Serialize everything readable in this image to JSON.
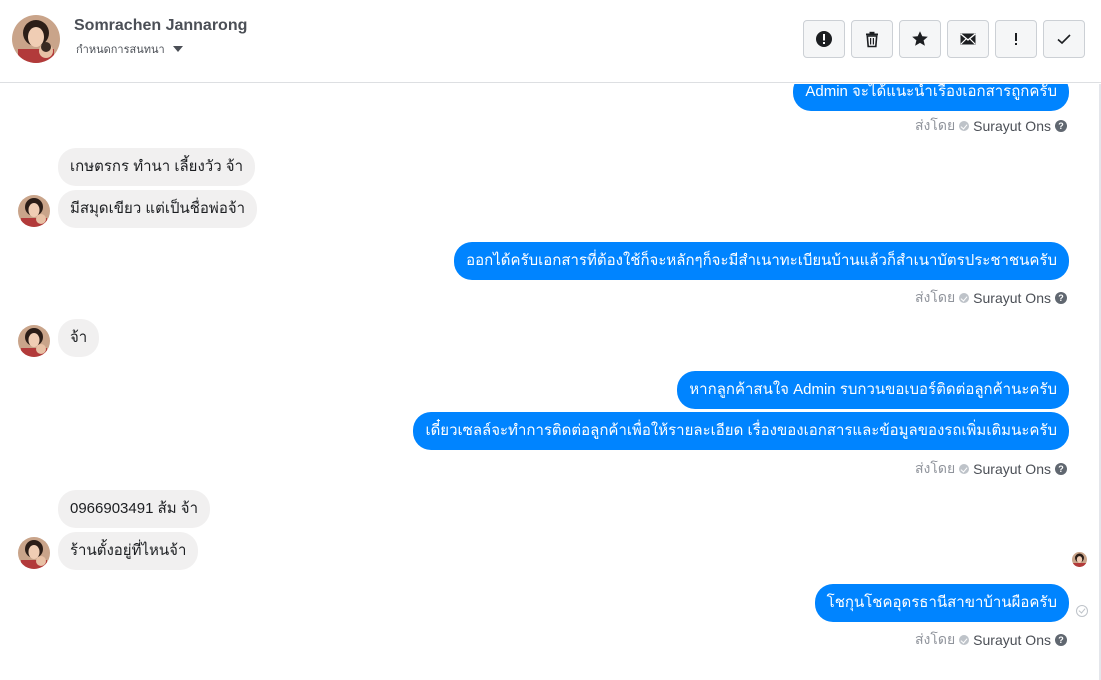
{
  "header": {
    "contact_name": "Somrachen Jannarong",
    "subtitle": "กำหนดการสนทนา",
    "actions": [
      {
        "name": "mark-spam-button",
        "icon": "alert-circle-icon"
      },
      {
        "name": "delete-button",
        "icon": "trash-icon"
      },
      {
        "name": "star-button",
        "icon": "star-icon"
      },
      {
        "name": "mark-unread-button",
        "icon": "envelope-icon"
      },
      {
        "name": "follow-up-button",
        "icon": "exclamation-icon"
      },
      {
        "name": "mark-done-button",
        "icon": "checkmark-icon"
      }
    ]
  },
  "conversation": {
    "sent_by_label": "ส่งโดย",
    "agent_name": "Surayut Ons",
    "messages": [
      {
        "direction": "out",
        "text": "Admin จะได้แนะนำเรื่องเอกสารถูกครับ"
      },
      {
        "direction": "in",
        "text": "เกษตรกร ทำนา เลี้ยงวัว จ้า"
      },
      {
        "direction": "in",
        "text": "มีสมุดเขียว  แต่เป็นชื่อพ่อจ้า"
      },
      {
        "direction": "out",
        "text": "ออกได้ครับเอกสารที่ต้องใช้ก็จะหลักๆก็จะมีสำเนาทะเบียนบ้านแล้วก็สำเนาบัตรประชาชนครับ"
      },
      {
        "direction": "in",
        "text": "จ้า"
      },
      {
        "direction": "out",
        "text": "หากลูกค้าสนใจ Admin รบกวนขอเบอร์ติดต่อลูกค้านะครับ"
      },
      {
        "direction": "out",
        "text": "เดี๋ยวเซลล์จะทำการติดต่อลูกค้าเพื่อให้รายละเอียด เรื่องของเอกสารและข้อมูลของรถเพิ่มเติมนะครับ"
      },
      {
        "direction": "in",
        "text": "0966903491 ส้ม จ้า"
      },
      {
        "direction": "in",
        "text": "ร้านตั้งอยู่ที่ไหนจ้า"
      },
      {
        "direction": "out",
        "text": "โชกุนโชคอุดรธานีสาขาบ้านผือครับ"
      }
    ]
  },
  "colors": {
    "outgoing_bubble": "#0084ff",
    "incoming_bubble": "#f1f0f0",
    "border": "#dddfe2"
  }
}
